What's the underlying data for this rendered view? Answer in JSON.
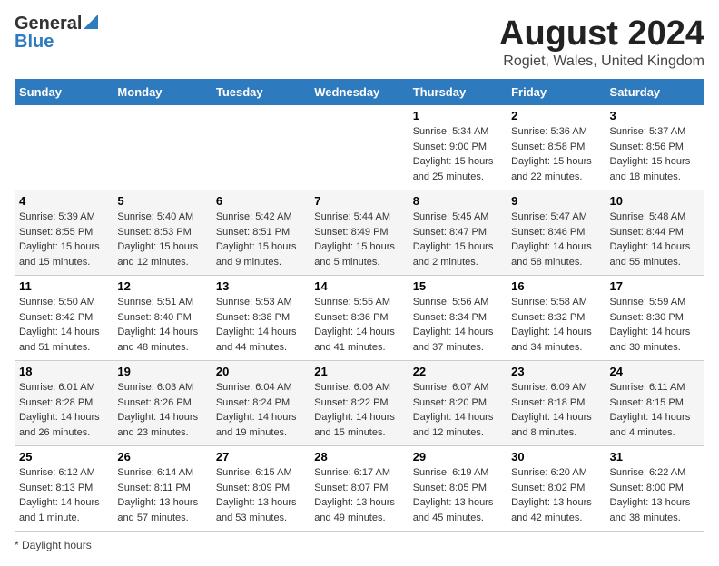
{
  "header": {
    "logo_general": "General",
    "logo_blue": "Blue",
    "month_title": "August 2024",
    "location": "Rogiet, Wales, United Kingdom"
  },
  "calendar": {
    "days_of_week": [
      "Sunday",
      "Monday",
      "Tuesday",
      "Wednesday",
      "Thursday",
      "Friday",
      "Saturday"
    ],
    "weeks": [
      [
        {
          "day": "",
          "info": ""
        },
        {
          "day": "",
          "info": ""
        },
        {
          "day": "",
          "info": ""
        },
        {
          "day": "",
          "info": ""
        },
        {
          "day": "1",
          "info": "Sunrise: 5:34 AM\nSunset: 9:00 PM\nDaylight: 15 hours and 25 minutes."
        },
        {
          "day": "2",
          "info": "Sunrise: 5:36 AM\nSunset: 8:58 PM\nDaylight: 15 hours and 22 minutes."
        },
        {
          "day": "3",
          "info": "Sunrise: 5:37 AM\nSunset: 8:56 PM\nDaylight: 15 hours and 18 minutes."
        }
      ],
      [
        {
          "day": "4",
          "info": "Sunrise: 5:39 AM\nSunset: 8:55 PM\nDaylight: 15 hours and 15 minutes."
        },
        {
          "day": "5",
          "info": "Sunrise: 5:40 AM\nSunset: 8:53 PM\nDaylight: 15 hours and 12 minutes."
        },
        {
          "day": "6",
          "info": "Sunrise: 5:42 AM\nSunset: 8:51 PM\nDaylight: 15 hours and 9 minutes."
        },
        {
          "day": "7",
          "info": "Sunrise: 5:44 AM\nSunset: 8:49 PM\nDaylight: 15 hours and 5 minutes."
        },
        {
          "day": "8",
          "info": "Sunrise: 5:45 AM\nSunset: 8:47 PM\nDaylight: 15 hours and 2 minutes."
        },
        {
          "day": "9",
          "info": "Sunrise: 5:47 AM\nSunset: 8:46 PM\nDaylight: 14 hours and 58 minutes."
        },
        {
          "day": "10",
          "info": "Sunrise: 5:48 AM\nSunset: 8:44 PM\nDaylight: 14 hours and 55 minutes."
        }
      ],
      [
        {
          "day": "11",
          "info": "Sunrise: 5:50 AM\nSunset: 8:42 PM\nDaylight: 14 hours and 51 minutes."
        },
        {
          "day": "12",
          "info": "Sunrise: 5:51 AM\nSunset: 8:40 PM\nDaylight: 14 hours and 48 minutes."
        },
        {
          "day": "13",
          "info": "Sunrise: 5:53 AM\nSunset: 8:38 PM\nDaylight: 14 hours and 44 minutes."
        },
        {
          "day": "14",
          "info": "Sunrise: 5:55 AM\nSunset: 8:36 PM\nDaylight: 14 hours and 41 minutes."
        },
        {
          "day": "15",
          "info": "Sunrise: 5:56 AM\nSunset: 8:34 PM\nDaylight: 14 hours and 37 minutes."
        },
        {
          "day": "16",
          "info": "Sunrise: 5:58 AM\nSunset: 8:32 PM\nDaylight: 14 hours and 34 minutes."
        },
        {
          "day": "17",
          "info": "Sunrise: 5:59 AM\nSunset: 8:30 PM\nDaylight: 14 hours and 30 minutes."
        }
      ],
      [
        {
          "day": "18",
          "info": "Sunrise: 6:01 AM\nSunset: 8:28 PM\nDaylight: 14 hours and 26 minutes."
        },
        {
          "day": "19",
          "info": "Sunrise: 6:03 AM\nSunset: 8:26 PM\nDaylight: 14 hours and 23 minutes."
        },
        {
          "day": "20",
          "info": "Sunrise: 6:04 AM\nSunset: 8:24 PM\nDaylight: 14 hours and 19 minutes."
        },
        {
          "day": "21",
          "info": "Sunrise: 6:06 AM\nSunset: 8:22 PM\nDaylight: 14 hours and 15 minutes."
        },
        {
          "day": "22",
          "info": "Sunrise: 6:07 AM\nSunset: 8:20 PM\nDaylight: 14 hours and 12 minutes."
        },
        {
          "day": "23",
          "info": "Sunrise: 6:09 AM\nSunset: 8:18 PM\nDaylight: 14 hours and 8 minutes."
        },
        {
          "day": "24",
          "info": "Sunrise: 6:11 AM\nSunset: 8:15 PM\nDaylight: 14 hours and 4 minutes."
        }
      ],
      [
        {
          "day": "25",
          "info": "Sunrise: 6:12 AM\nSunset: 8:13 PM\nDaylight: 14 hours and 1 minute."
        },
        {
          "day": "26",
          "info": "Sunrise: 6:14 AM\nSunset: 8:11 PM\nDaylight: 13 hours and 57 minutes."
        },
        {
          "day": "27",
          "info": "Sunrise: 6:15 AM\nSunset: 8:09 PM\nDaylight: 13 hours and 53 minutes."
        },
        {
          "day": "28",
          "info": "Sunrise: 6:17 AM\nSunset: 8:07 PM\nDaylight: 13 hours and 49 minutes."
        },
        {
          "day": "29",
          "info": "Sunrise: 6:19 AM\nSunset: 8:05 PM\nDaylight: 13 hours and 45 minutes."
        },
        {
          "day": "30",
          "info": "Sunrise: 6:20 AM\nSunset: 8:02 PM\nDaylight: 13 hours and 42 minutes."
        },
        {
          "day": "31",
          "info": "Sunrise: 6:22 AM\nSunset: 8:00 PM\nDaylight: 13 hours and 38 minutes."
        }
      ]
    ]
  },
  "footer": {
    "note": "Daylight hours"
  }
}
